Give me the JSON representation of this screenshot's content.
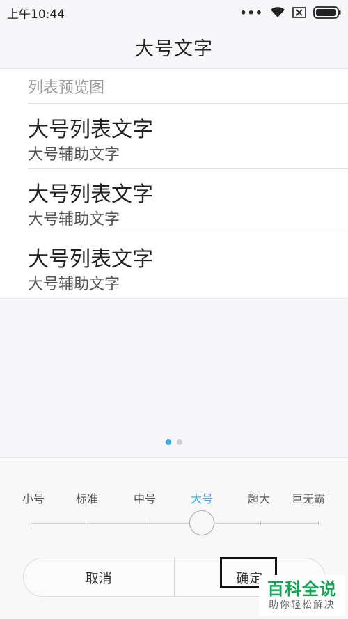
{
  "status_bar": {
    "time": "上午10:44",
    "dots": "•••",
    "icons": [
      "wifi-icon",
      "sim-icon",
      "battery-icon"
    ]
  },
  "header": {
    "title": "大号文字"
  },
  "preview": {
    "header": "列表预览图",
    "items": [
      {
        "title": "大号列表文字",
        "subtitle": "大号辅助文字"
      },
      {
        "title": "大号列表文字",
        "subtitle": "大号辅助文字"
      },
      {
        "title": "大号列表文字",
        "subtitle": "大号辅助文字"
      }
    ]
  },
  "pager": {
    "total": 2,
    "active": 0
  },
  "font_size": {
    "options": [
      "小号",
      "标准",
      "中号",
      "大号",
      "超大",
      "巨无霸"
    ],
    "selected": "大号"
  },
  "buttons": {
    "cancel": "取消",
    "confirm": "确定"
  },
  "watermark": {
    "main": "百科全说",
    "sub": "助你轻松解决"
  },
  "colors": {
    "accent": "#3aaae0",
    "watermark": "#16a556"
  }
}
